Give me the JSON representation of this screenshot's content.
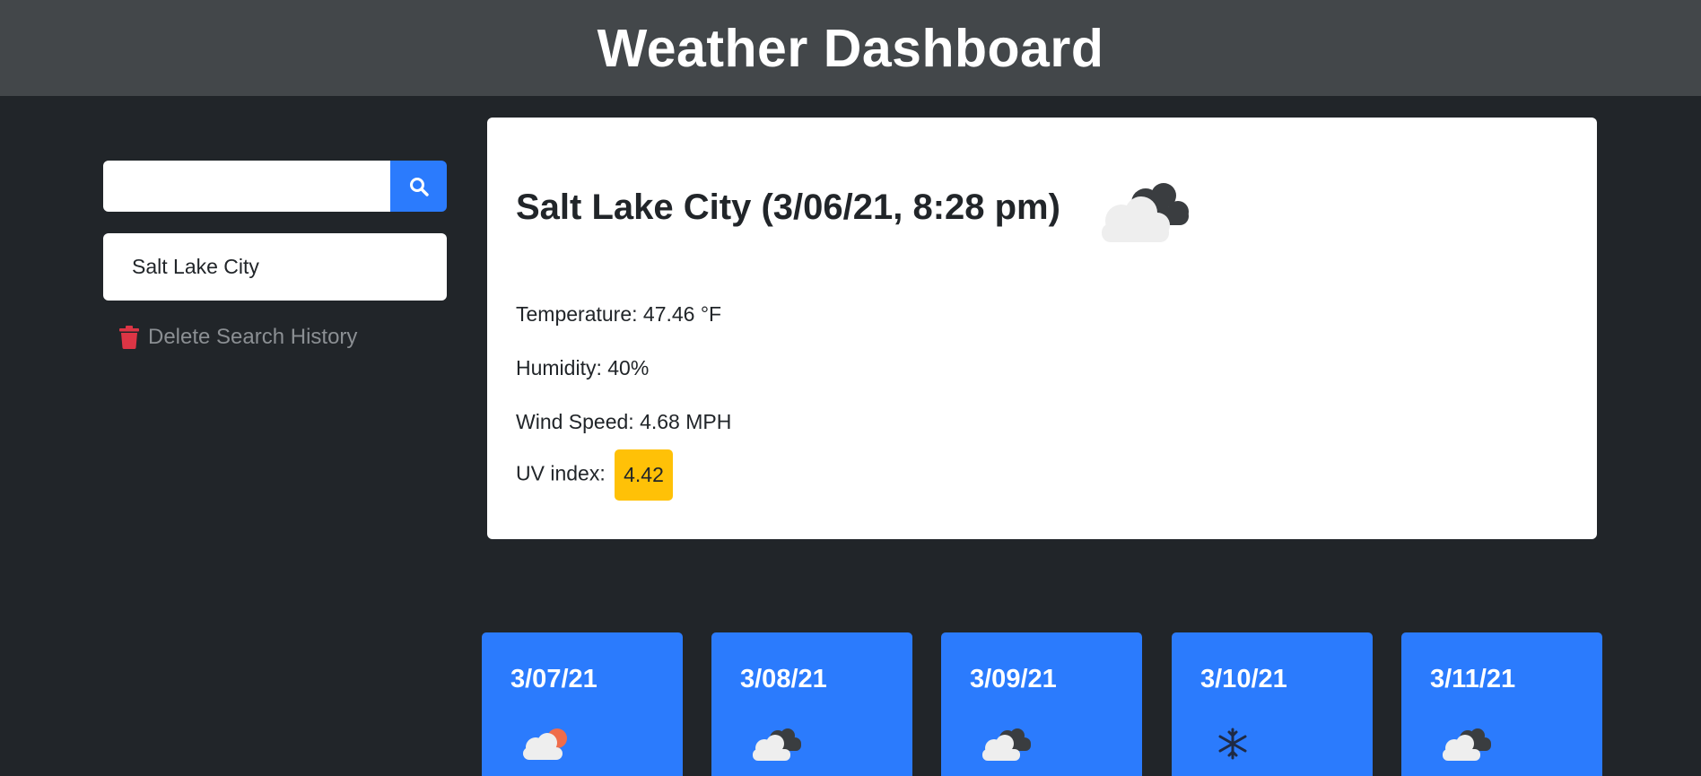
{
  "header": {
    "title": "Weather Dashboard"
  },
  "search": {
    "placeholder": "",
    "value": "",
    "button_icon": "search-icon"
  },
  "history": {
    "items": [
      {
        "label": "Salt Lake City"
      }
    ]
  },
  "delete_history": {
    "label": "Delete Search History",
    "icon": "trash-icon",
    "icon_color": "#dc3545"
  },
  "current": {
    "title": "Salt Lake City (3/06/21, 8:28 pm)",
    "icon": "broken-clouds-icon",
    "temperature": "Temperature: 47.46 °F",
    "humidity": "Humidity: 40%",
    "wind": "Wind Speed: 4.68 MPH",
    "uv_label": "UV index:",
    "uv_value": "4.42",
    "uv_color": "#ffc107"
  },
  "forecast": [
    {
      "date": "3/07/21",
      "icon": "partly-sunny-icon"
    },
    {
      "date": "3/08/21",
      "icon": "broken-clouds-icon"
    },
    {
      "date": "3/09/21",
      "icon": "broken-clouds-icon"
    },
    {
      "date": "3/10/21",
      "icon": "snowflake-icon"
    },
    {
      "date": "3/11/21",
      "icon": "broken-clouds-icon"
    }
  ],
  "colors": {
    "background": "#212529",
    "header": "#43474a",
    "accent": "#2b7bfd",
    "uv_moderate": "#ffc107",
    "danger": "#dc3545"
  }
}
